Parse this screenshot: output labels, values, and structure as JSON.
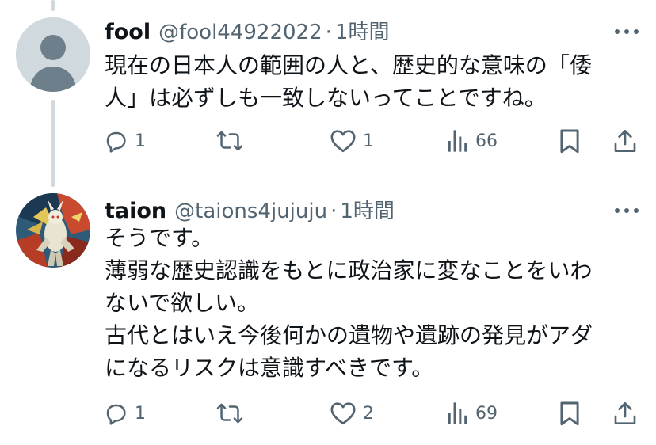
{
  "posts": [
    {
      "author_name": "fool",
      "handle": "@fool44922022",
      "separator": "·",
      "time": "1時間",
      "lines": [
        "現在の日本人の範囲の人と、歴史的な意味の「倭",
        "人」は必ずしも一致しないってことですね。"
      ],
      "actions": {
        "replies": "1",
        "reposts": "",
        "likes": "1",
        "views": "66"
      }
    },
    {
      "author_name": "taion",
      "handle": "@taions4jujuju",
      "separator": "·",
      "time": "1時間",
      "lines": [
        "そうです。",
        "薄弱な歴史認識をもとに政治家に変なことをいわ",
        "ないで欲しい。",
        "古代とはいえ今後何かの遺物や遺跡の発見がアダ",
        "になるリスクは意識すべきです。"
      ],
      "actions": {
        "replies": "1",
        "reposts": "",
        "likes": "2",
        "views": "69"
      }
    }
  ],
  "icons": {
    "reply": "reply-icon",
    "repost": "repost-icon",
    "like": "heart-icon",
    "views": "views-icon",
    "bookmark": "bookmark-icon",
    "share": "share-icon",
    "more": "more-icon"
  },
  "colors": {
    "text": "#0f1419",
    "secondary": "#536471",
    "thread_line": "#cfd9de"
  }
}
